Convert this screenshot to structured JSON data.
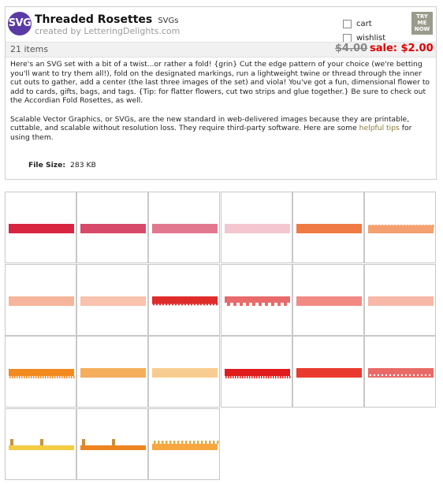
{
  "badge": "SVG",
  "title": "Threaded Rosettes",
  "title_suffix": "SVGs",
  "creator": "created by LetteringDelights.com",
  "options": {
    "cart": "cart",
    "wishlist": "wishlist"
  },
  "try_me": [
    "TRY",
    "ME",
    "NOW"
  ],
  "items_count": "21 items",
  "price": {
    "original": "$4.00",
    "sale": "sale: $2.00"
  },
  "description": {
    "p1": "Here's an SVG set with a bit of a twist...or rather a fold! {grin} Cut the edge pattern of your choice (we're betting you'll want to try them all!), fold on the designated markings, run a lightweight twine or thread through the inner cut outs to gather, add a center (the last three images of the set) and viola! You've got a fun, dimensional flower to add to cards, gifts, bags, and tags. {Tip: for flatter flowers, cut two strips and glue together.} Be sure to check out the Accordian Fold Rosettes, as well.",
    "p2_before": "Scalable Vector Graphics, or SVGs, are the new standard in web-delivered images because they are printable, cuttable, and scalable without resolution loss. They require third-party software. Here are some ",
    "p2_link": "helpful tips",
    "p2_after": " for using them."
  },
  "file_size": {
    "label": "File Size:",
    "value": "283 KB"
  },
  "thumbnails": [
    {
      "color": "#d8243f",
      "style": "flat"
    },
    {
      "color": "#d84a6a",
      "style": "flat"
    },
    {
      "color": "#e27890",
      "style": "flat"
    },
    {
      "color": "#f4c6cf",
      "style": "flat"
    },
    {
      "color": "#f07a44",
      "style": "flat"
    },
    {
      "color": "#f4a070",
      "style": "scallop"
    },
    {
      "color": "#f6b59a",
      "style": "flat"
    },
    {
      "color": "#f8c2ac",
      "style": "flat"
    },
    {
      "color": "#e02b2b",
      "style": "zigzag"
    },
    {
      "color": "#e86a6a",
      "style": "drip"
    },
    {
      "color": "#f28a84",
      "style": "flat"
    },
    {
      "color": "#f7b8a8",
      "style": "flat"
    },
    {
      "color": "#f28a20",
      "style": "fringe"
    },
    {
      "color": "#f5ae5c",
      "style": "flat"
    },
    {
      "color": "#f8cc90",
      "style": "flat"
    },
    {
      "color": "#e01c1c",
      "style": "fringe"
    },
    {
      "color": "#ea3a2e",
      "style": "flat"
    },
    {
      "color": "#e86a66",
      "style": "dots"
    },
    {
      "color": "#f3cc44",
      "style": "tabs"
    },
    {
      "color": "#ee8420",
      "style": "tabs"
    },
    {
      "color": "#f8a640",
      "style": "crown"
    }
  ]
}
